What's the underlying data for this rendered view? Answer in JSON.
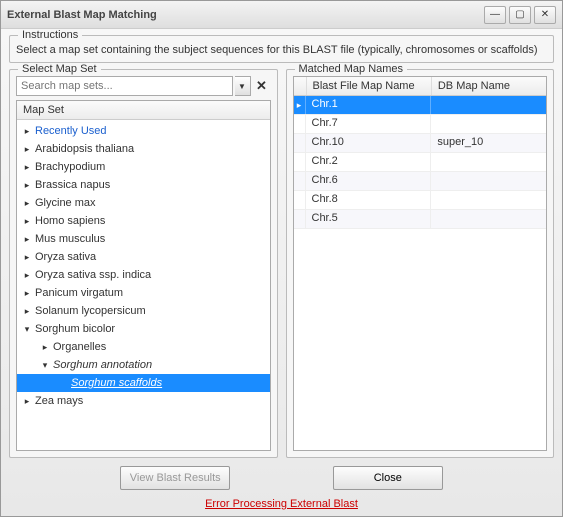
{
  "window": {
    "title": "External Blast Map Matching"
  },
  "instructions": {
    "legend": "Instructions",
    "text": "Select a map set containing the subject sequences for this BLAST file (typically, chromosomes or scaffolds)"
  },
  "selectMapSet": {
    "legend": "Select Map Set",
    "search": {
      "placeholder": "Search map sets..."
    },
    "treeHeader": "Map Set",
    "tree": [
      {
        "label": "Recently Used",
        "arrow": "▸",
        "indent": 0,
        "recently": true
      },
      {
        "label": "Arabidopsis thaliana",
        "arrow": "▸",
        "indent": 0
      },
      {
        "label": "Brachypodium",
        "arrow": "▸",
        "indent": 0
      },
      {
        "label": "Brassica napus",
        "arrow": "▸",
        "indent": 0
      },
      {
        "label": "Glycine max",
        "arrow": "▸",
        "indent": 0
      },
      {
        "label": "Homo sapiens",
        "arrow": "▸",
        "indent": 0
      },
      {
        "label": "Mus musculus",
        "arrow": "▸",
        "indent": 0
      },
      {
        "label": "Oryza sativa",
        "arrow": "▸",
        "indent": 0
      },
      {
        "label": "Oryza sativa ssp. indica",
        "arrow": "▸",
        "indent": 0
      },
      {
        "label": "Panicum virgatum",
        "arrow": "▸",
        "indent": 0
      },
      {
        "label": "Solanum lycopersicum",
        "arrow": "▸",
        "indent": 0
      },
      {
        "label": "Sorghum bicolor",
        "arrow": "▾",
        "indent": 0
      },
      {
        "label": "Organelles",
        "arrow": "▸",
        "indent": 1
      },
      {
        "label": "Sorghum annotation",
        "arrow": "▾",
        "indent": 1,
        "italic": true
      },
      {
        "label": "Sorghum scaffolds",
        "arrow": "",
        "indent": 2,
        "italic": true,
        "selected": true
      },
      {
        "label": "Zea mays",
        "arrow": "▸",
        "indent": 0
      }
    ]
  },
  "matched": {
    "legend": "Matched Map Names",
    "headers": {
      "blast": "Blast File Map Name",
      "db": "DB Map Name"
    },
    "rows": [
      {
        "blast": "Chr.1",
        "db": "",
        "selected": true,
        "indicator": "▸"
      },
      {
        "blast": "Chr.7",
        "db": ""
      },
      {
        "blast": "Chr.10",
        "db": "super_10"
      },
      {
        "blast": "Chr.2",
        "db": ""
      },
      {
        "blast": "Chr.6",
        "db": ""
      },
      {
        "blast": "Chr.8",
        "db": ""
      },
      {
        "blast": "Chr.5",
        "db": ""
      }
    ]
  },
  "buttons": {
    "viewResults": "View Blast Results",
    "close": "Close"
  },
  "error": "Error Processing External Blast"
}
